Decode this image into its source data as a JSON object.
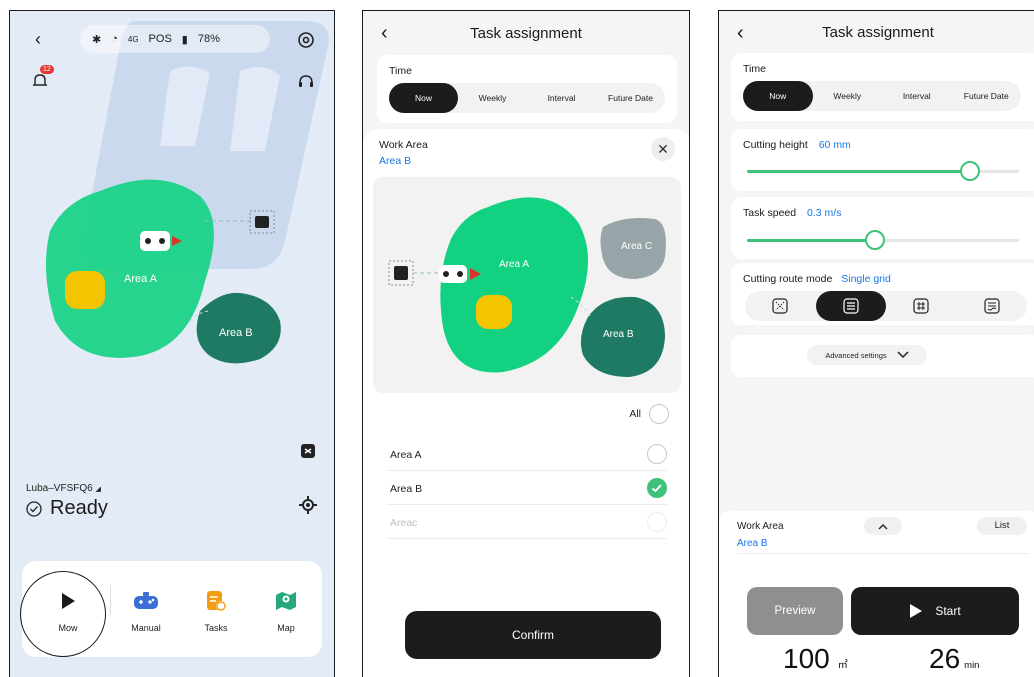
{
  "screen1": {
    "status": {
      "network": "4G",
      "pos": "POS",
      "battery": "78%"
    },
    "notifications_count": "12",
    "map": {
      "area_a": "Area A",
      "area_b": "Area B"
    },
    "device_name": "Luba–VFSFQ6",
    "device_status": "Ready",
    "tabs": [
      {
        "label": "Mow",
        "icon": "play-icon"
      },
      {
        "label": "Manual",
        "icon": "gamepad-icon"
      },
      {
        "label": "Tasks",
        "icon": "tasks-icon"
      },
      {
        "label": "Map",
        "icon": "map-icon"
      }
    ]
  },
  "screen2": {
    "title": "Task assignment",
    "time_label": "Time",
    "time_options": [
      "Now",
      "Weekly",
      "Interval",
      "Future Date"
    ],
    "time_selected": "Now",
    "work_area_label": "Work Area",
    "work_area_value": "Area B",
    "map": {
      "area_a": "Area A",
      "area_b": "Area B",
      "area_c": "Area C"
    },
    "all_label": "All",
    "areas": [
      {
        "name": "Area A",
        "checked": false,
        "disabled": false
      },
      {
        "name": "Area B",
        "checked": true,
        "disabled": false
      },
      {
        "name": "Areac",
        "checked": false,
        "disabled": true
      }
    ],
    "confirm_label": "Confirm"
  },
  "screen3": {
    "title": "Task assignment",
    "time_label": "Time",
    "time_options": [
      "Now",
      "Weekly",
      "Interval",
      "Future Date"
    ],
    "time_selected": "Now",
    "cutting_height_label": "Cutting height",
    "cutting_height_value": "60 mm",
    "cutting_height_level": 0.82,
    "task_speed_label": "Task speed",
    "task_speed_value": "0.3 m/s",
    "task_speed_level": 0.47,
    "route_mode_label": "Cutting route mode",
    "route_mode_value": "Single grid",
    "route_modes": [
      "random-pattern-icon",
      "single-grid-icon",
      "double-grid-icon",
      "zigzag-pattern-icon"
    ],
    "advanced_label": "Advanced settings",
    "work_area_label": "Work Area",
    "work_area_value": "Area B",
    "list_label": "List",
    "preview_label": "Preview",
    "start_label": "Start",
    "area_value": "100",
    "area_unit": "㎡",
    "time_value": "26",
    "time_unit": "min"
  },
  "colors": {
    "accent_green": "#3ec27a",
    "area_green": "#12d282",
    "area_dark": "#1f7a63",
    "area_gray": "#97a5a8",
    "link_blue": "#1677e6",
    "dark": "#1c1c1c"
  }
}
